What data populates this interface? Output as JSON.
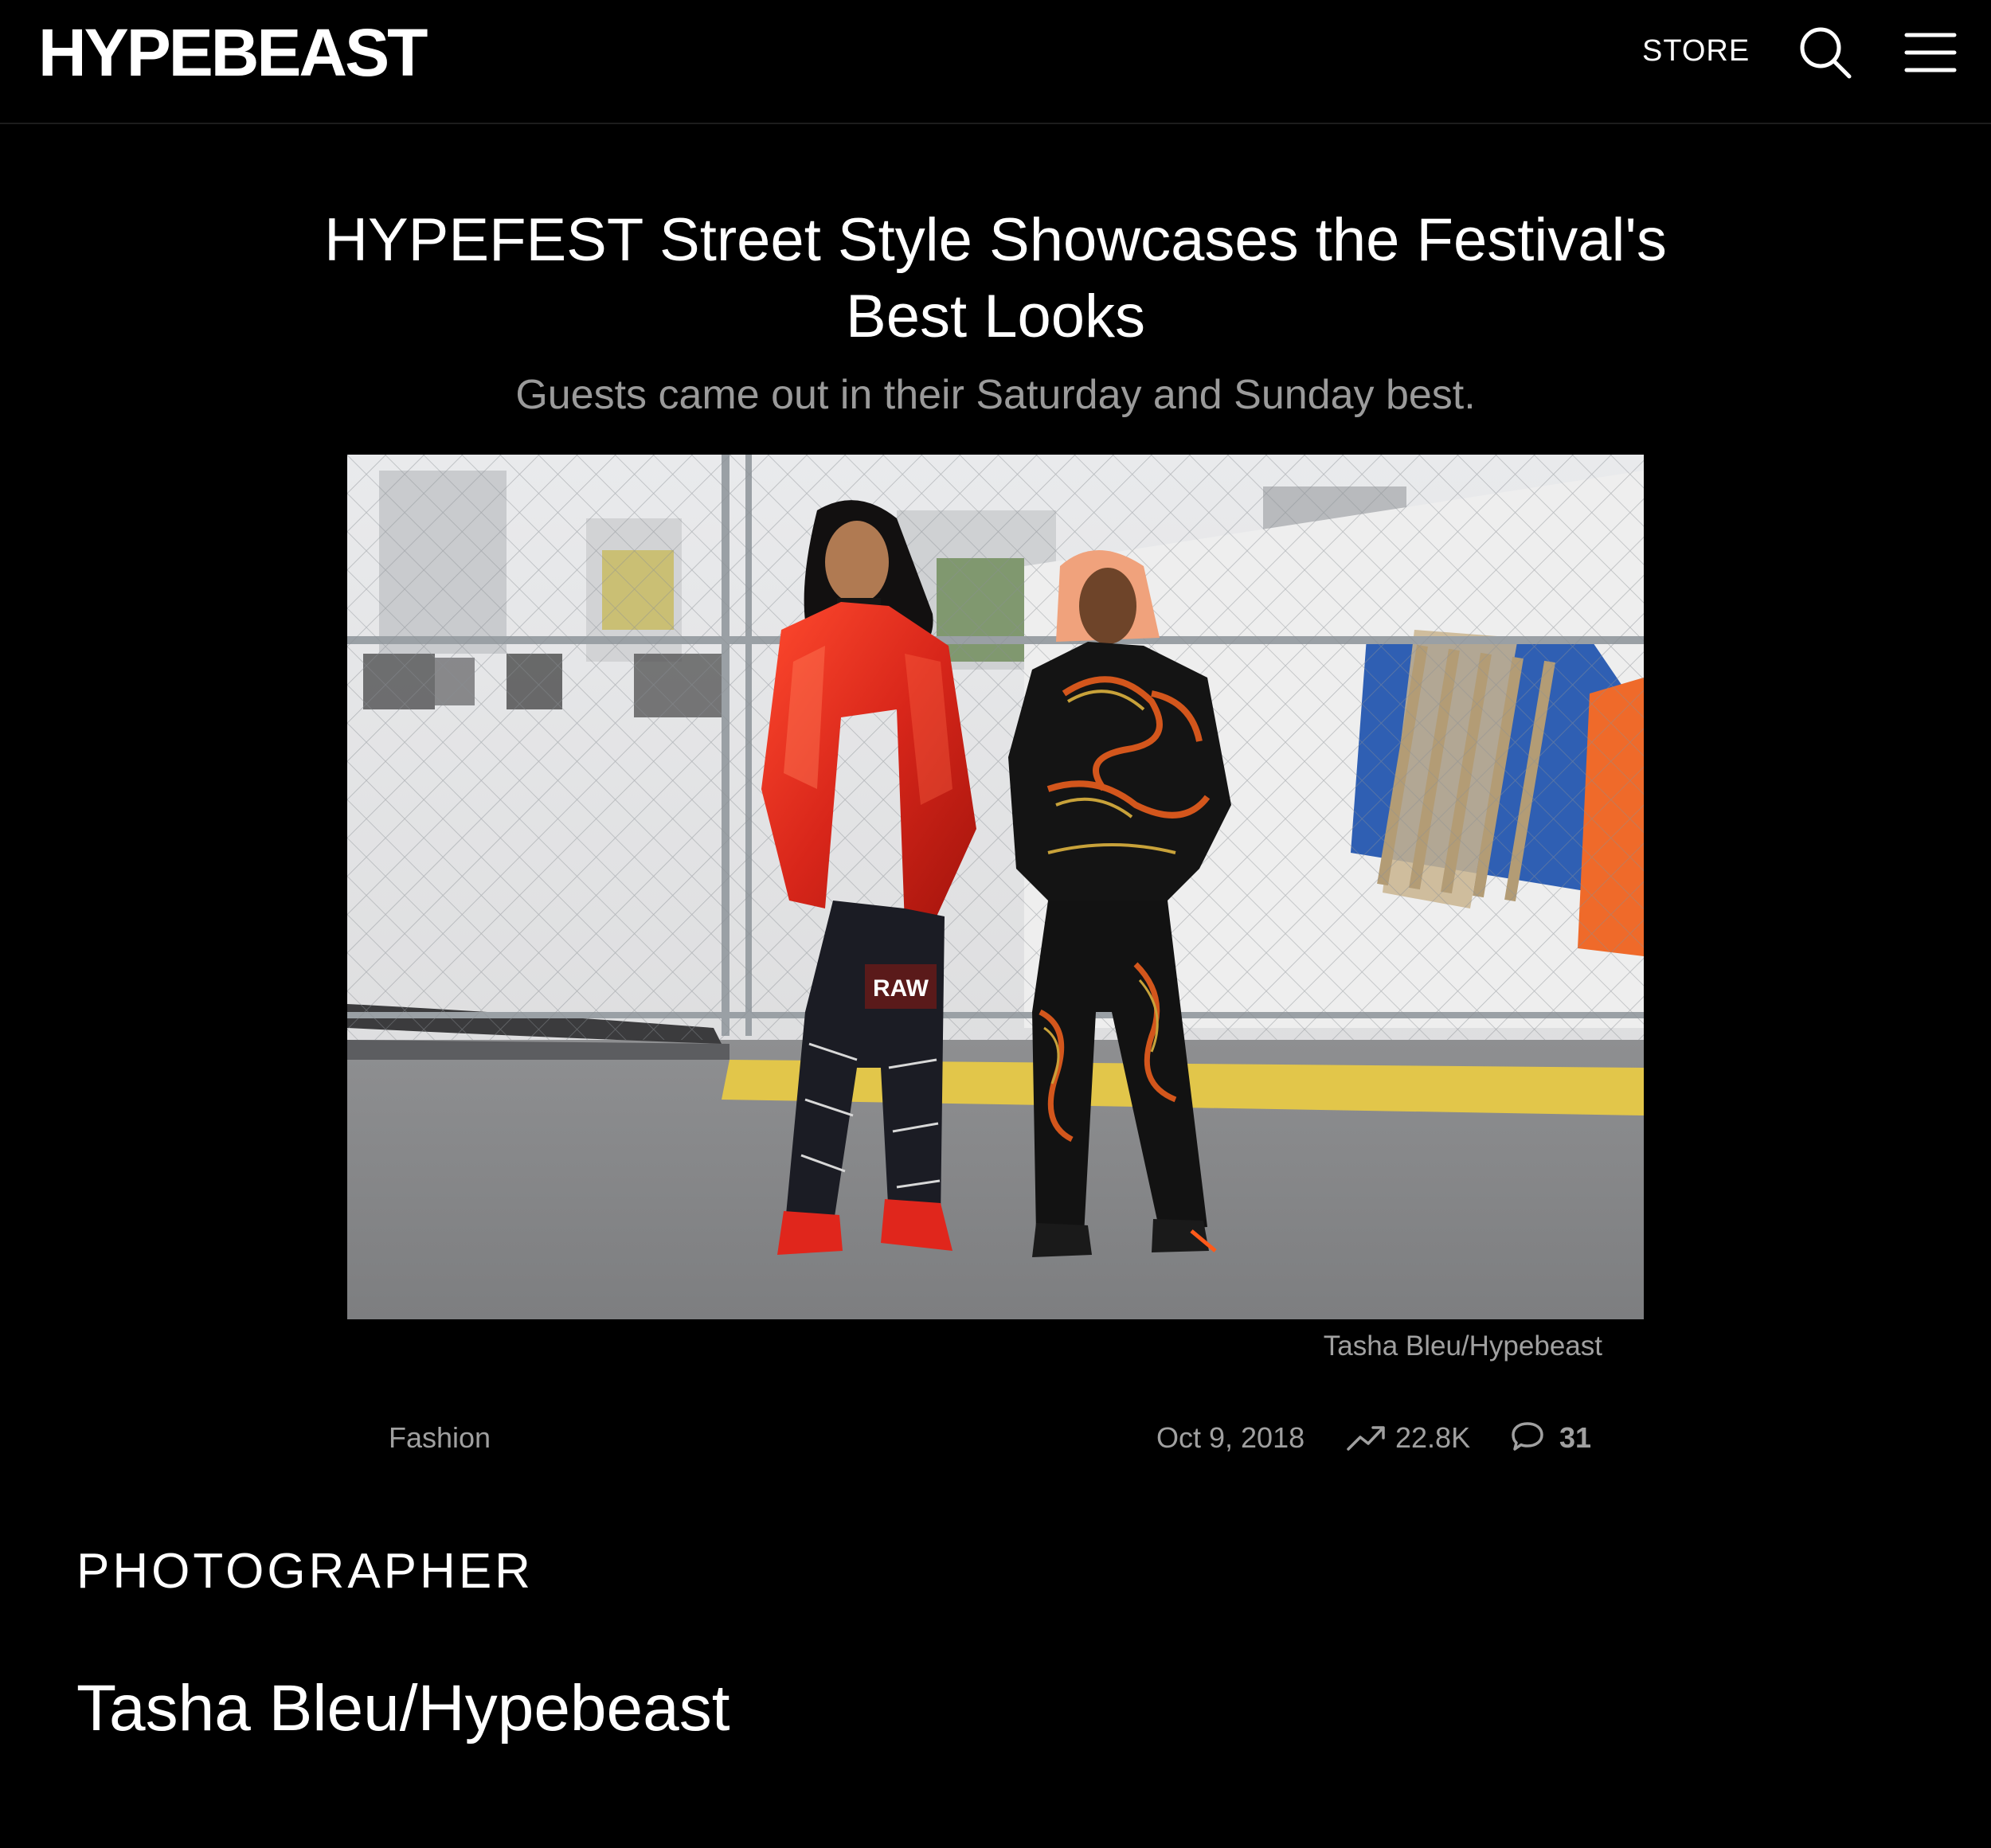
{
  "header": {
    "logo_text": "HYPEBEAST",
    "store_label": "STORE",
    "search_icon": "search-icon",
    "menu_icon": "hamburger-menu-icon"
  },
  "article": {
    "title": "HYPEFEST Street Style Showcases the Festival's Best Looks",
    "subtitle": "Guests came out in their Saturday and Sunday best.",
    "hero_image": {
      "credit": "Tasha Bleu/Hypebeast"
    },
    "meta": {
      "category": "Fashion",
      "date": "Oct 9, 2018",
      "views": "22.8K",
      "views_icon": "trending-up-icon",
      "comments": "31",
      "comments_icon": "comment-bubble-icon"
    },
    "photographer": {
      "label": "PHOTOGRAPHER",
      "name": "Tasha Bleu/Hypebeast"
    }
  },
  "colors": {
    "background": "#000000",
    "text_primary": "#ffffff",
    "text_secondary": "#a0a0a0",
    "jacket_red": "#d8261a"
  }
}
